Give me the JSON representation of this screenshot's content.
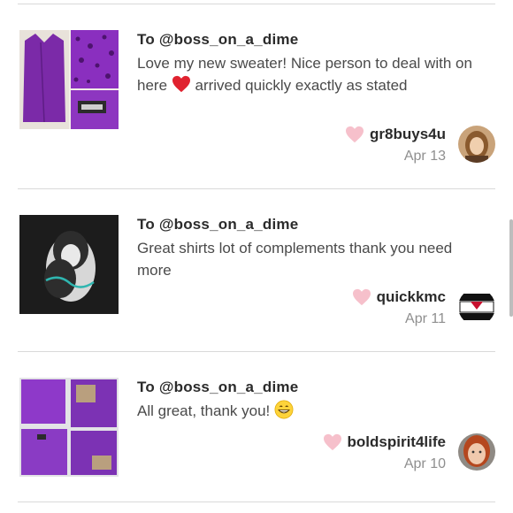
{
  "reviews": [
    {
      "to": "To @boss_on_a_dime",
      "message_part1": "Love my new sweater! Nice person to deal with on here",
      "message_part2": "arrived quickly exactly as stated",
      "username": "gr8buys4u",
      "date": "Apr 13",
      "heart_color": "#f4b7c4"
    },
    {
      "to": "To @boss_on_a_dime",
      "message": "Great shirts lot of complements thank you need more",
      "username": "quickkmc",
      "date": "Apr 11",
      "heart_color": "#f4b7c4"
    },
    {
      "to": "To @boss_on_a_dime",
      "message": "All great, thank you!",
      "username": "boldspirit4life",
      "date": "Apr 10",
      "heart_color": "#f4b7c4"
    }
  ],
  "colors": {
    "accent_heart": "#e0222f",
    "purple": "#7b2fa6"
  }
}
